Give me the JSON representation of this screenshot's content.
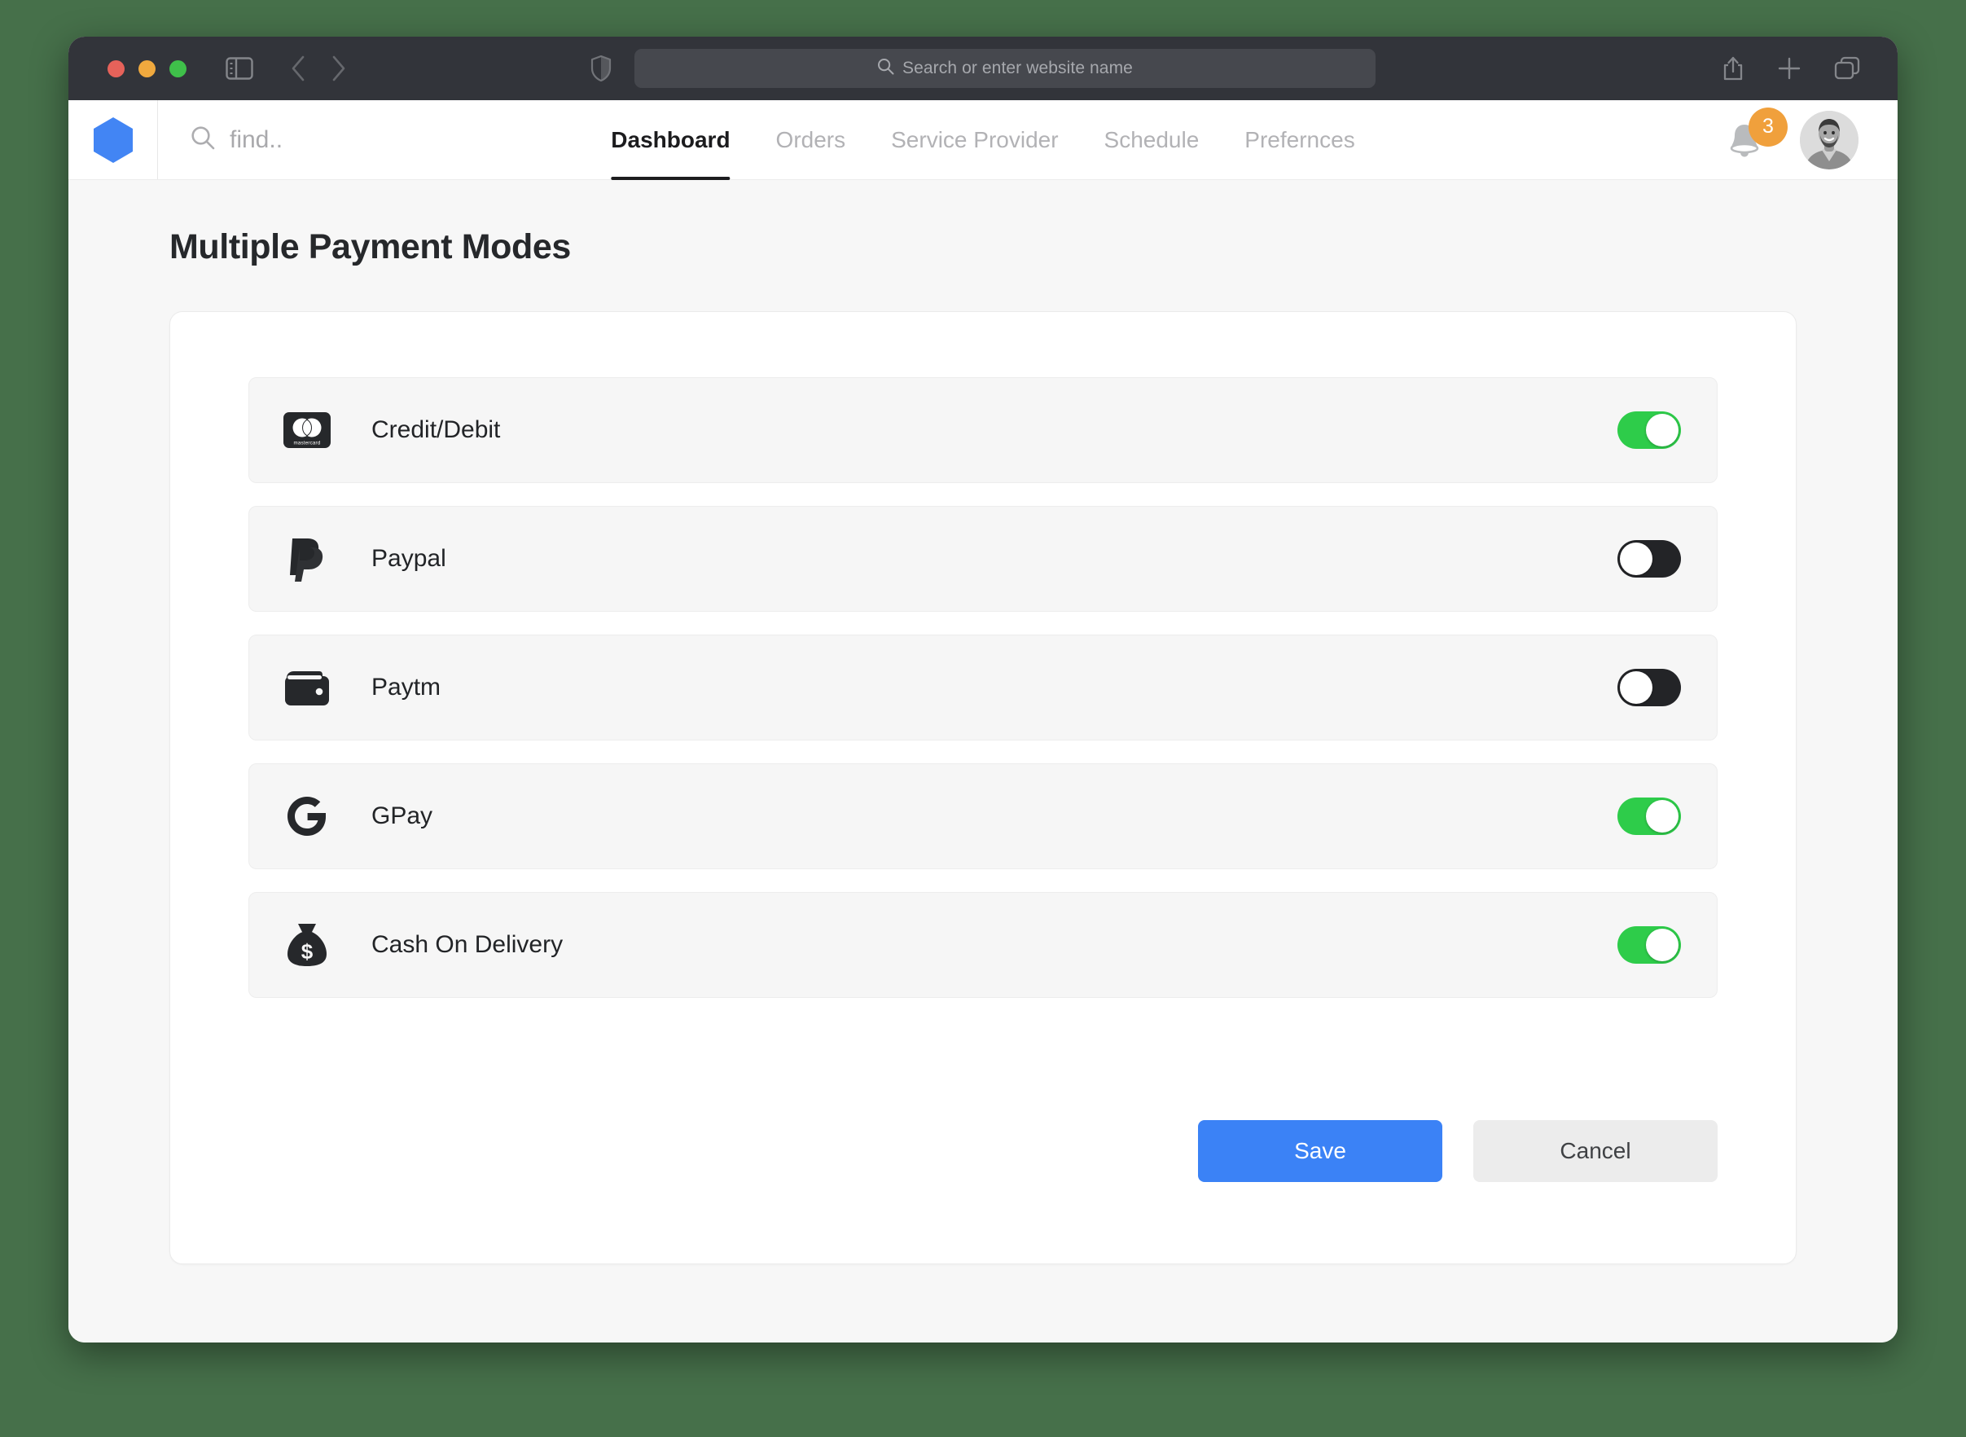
{
  "browser": {
    "traffic_lights": [
      "close",
      "minimize",
      "maximize"
    ],
    "sidebar_toggle_icon": "sidebar-icon",
    "back_icon": "chevron-left-icon",
    "forward_icon": "chevron-right-icon",
    "shield_icon": "shield-icon",
    "url_placeholder": "Search or enter website name",
    "url_value": "",
    "search_icon": "search-icon",
    "share_icon": "share-icon",
    "new_tab_icon": "plus-icon",
    "tabs_icon": "tab-overview-icon"
  },
  "app_header": {
    "logo_icon": "hexagon-logo-icon",
    "logo_color": "#4285f4",
    "search_icon": "search-icon",
    "search_placeholder": "find..",
    "search_value": "",
    "nav_items": [
      {
        "label": "Dashboard",
        "active": true
      },
      {
        "label": "Orders",
        "active": false
      },
      {
        "label": "Service Provider",
        "active": false
      },
      {
        "label": "Schedule",
        "active": false
      },
      {
        "label": "Prefernces",
        "active": false
      }
    ],
    "bell_icon": "bell-icon",
    "notification_count": "3",
    "notification_badge_color": "#f0a03c",
    "avatar_icon": "user-avatar"
  },
  "page": {
    "title": "Multiple Payment Modes"
  },
  "payment_methods": [
    {
      "label": "Credit/Debit",
      "icon": "mastercard-icon",
      "enabled": true
    },
    {
      "label": "Paypal",
      "icon": "paypal-icon",
      "enabled": false
    },
    {
      "label": "Paytm",
      "icon": "wallet-icon",
      "enabled": false
    },
    {
      "label": "GPay",
      "icon": "google-g-icon",
      "enabled": true
    },
    {
      "label": "Cash On Delivery",
      "icon": "money-bag-icon",
      "enabled": true
    }
  ],
  "actions": {
    "save_label": "Save",
    "cancel_label": "Cancel",
    "save_color": "#3b82f6",
    "cancel_color": "#ececec"
  },
  "colors": {
    "desktop_background": "#46704a",
    "toggle_on": "#2ecc4a",
    "toggle_off": "#232427",
    "accent": "#3b82f6"
  }
}
